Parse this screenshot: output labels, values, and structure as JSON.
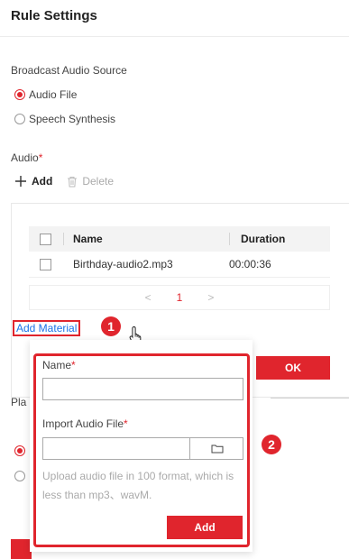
{
  "header": {
    "title": "Rule Settings"
  },
  "broadcast": {
    "label": "Broadcast Audio Source",
    "options": [
      {
        "label": "Audio File",
        "selected": true
      },
      {
        "label": "Speech Synthesis",
        "selected": false
      }
    ]
  },
  "audio": {
    "label": "Audio",
    "required_mark": "*",
    "add_label": "Add",
    "delete_label": "Delete"
  },
  "table": {
    "columns": [
      "Name",
      "Duration"
    ],
    "rows": [
      {
        "name": "Birthday-audio2.mp3",
        "duration": "00:00:36"
      }
    ],
    "pager": {
      "prev": "<",
      "page": "1",
      "next": ">"
    }
  },
  "add_material_label": "Add Material",
  "ok_label": "OK",
  "background_partial_text": "Pla",
  "popup": {
    "name_label": "Name",
    "name_value": "",
    "import_label": "Import Audio File",
    "file_value": "",
    "required_mark": "*",
    "hint": "Upload audio file in 100 format, which is less than mp3、wavM.",
    "add_label": "Add"
  },
  "annotations": {
    "badge1": "1",
    "badge2": "2"
  },
  "colors": {
    "accent": "#e0252d",
    "link": "#1a73e8"
  }
}
